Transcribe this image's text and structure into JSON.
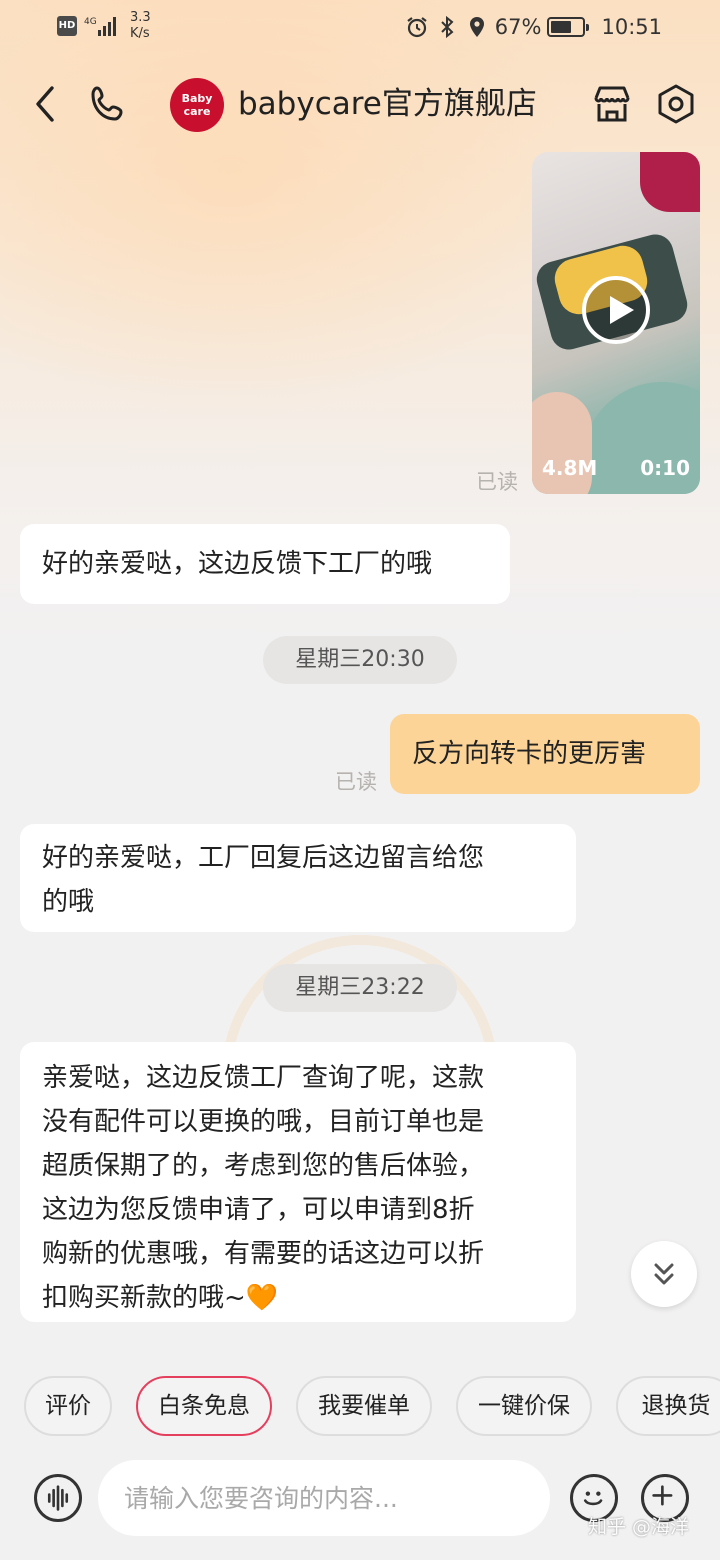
{
  "status_bar": {
    "hd": "HD",
    "network": "4G",
    "speed_value": "3.3",
    "speed_unit": "K/s",
    "battery": "67%",
    "time": "10:51"
  },
  "header": {
    "logo_line1": "Baby",
    "logo_line2": "care",
    "store_name": "babycare官方旗舰店"
  },
  "messages": {
    "video": {
      "size": "4.8M",
      "duration": "0:10",
      "read": "已读"
    },
    "reply1": "好的亲爱哒，这边反馈下工厂的哦",
    "time1": "星期三20:30",
    "user1": "反方向转卡的更厉害",
    "user1_read": "已读",
    "reply2_line1": "好的亲爱哒，工厂回复后这边留言给您",
    "reply2_line2": "的哦",
    "time2": "星期三23:22",
    "reply3_lines": [
      "亲爱哒，这边反馈工厂查询了呢，这款",
      "没有配件可以更换的哦，目前订单也是",
      "超质保期了的，考虑到您的售后体验，",
      "这边为您反馈申请了，可以申请到8折",
      "购新的优惠哦，有需要的话这边可以折",
      "扣购买新款的哦~🧡"
    ]
  },
  "quick_actions": [
    "评价",
    "白条免息",
    "我要催单",
    "一键价保",
    "退换货"
  ],
  "input": {
    "placeholder": "请输入您要咨询的内容..."
  },
  "watermark": "知乎 @海洋",
  "colors": {
    "accent": "#e53f5e",
    "user_bubble": "#fcd497",
    "brand": "#c8102e"
  }
}
